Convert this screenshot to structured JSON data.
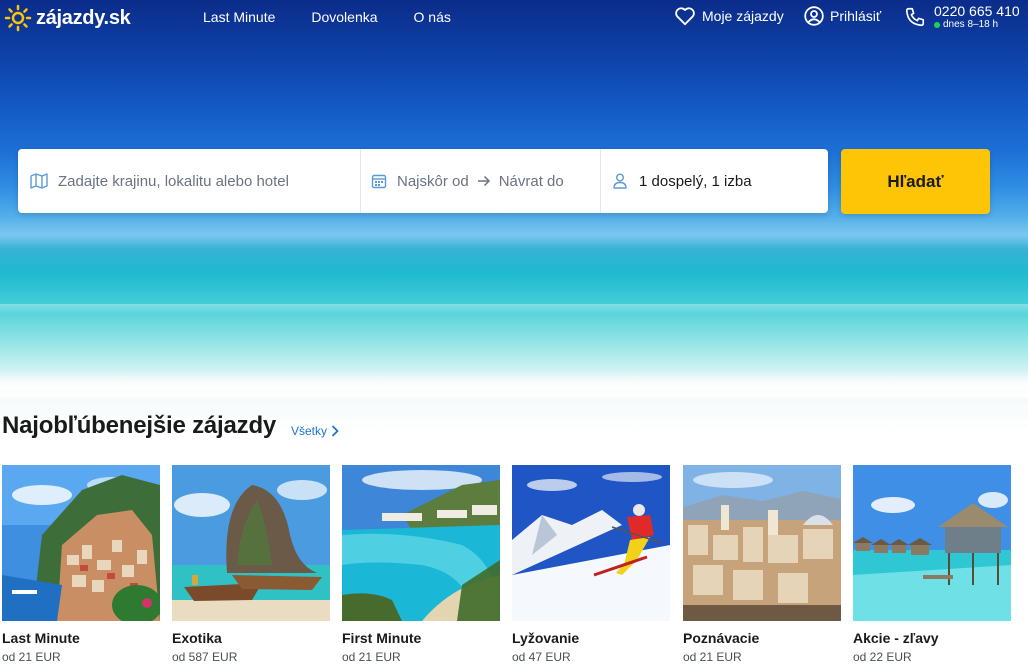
{
  "brand": {
    "name": "zájazdy.sk"
  },
  "nav": {
    "items": [
      "Last Minute",
      "Dovolenka",
      "O nás"
    ]
  },
  "header": {
    "favorites_label": "Moje zájazdy",
    "login_label": "Prihlásiť",
    "phone": "0220 665 410",
    "phone_hours": "dnes 8–18 h"
  },
  "search": {
    "destination_placeholder": "Zadajte krajinu, lokalitu alebo hotel",
    "date_from": "Najskôr od",
    "date_to": "Návrat do",
    "passengers": "1 dospelý, 1 izba",
    "button": "Hľadať"
  },
  "section": {
    "title": "Najobľúbenejšie zájazdy",
    "link": "Všetky"
  },
  "cards": [
    {
      "name": "Last Minute",
      "price": "od 21 EUR"
    },
    {
      "name": "Exotika",
      "price": "od 587 EUR"
    },
    {
      "name": "First Minute",
      "price": "od 21 EUR"
    },
    {
      "name": "Lyžovanie",
      "price": "od 47 EUR"
    },
    {
      "name": "Poznávacie",
      "price": "od 21 EUR"
    },
    {
      "name": "Akcie - zľavy",
      "price": "od 22 EUR"
    }
  ],
  "colors": {
    "accent": "#fdc506",
    "link": "#1c75d0",
    "sky": "#0d3ea3"
  }
}
